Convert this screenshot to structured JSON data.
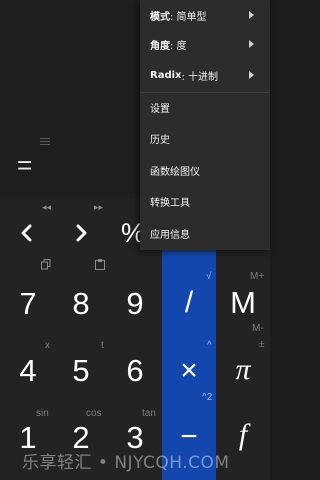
{
  "display": {
    "equals_sign": "="
  },
  "nav_row": {
    "rewind_icon": "◂◂",
    "forward_icon": "▸▸",
    "percent_label": "%"
  },
  "clipboard_row": {
    "copy_icon": "copy-icon",
    "paste_icon": "paste-icon"
  },
  "keypad": {
    "row1": {
      "d7": "7",
      "d8": "8",
      "d9": "9",
      "div": "/",
      "mem": "M"
    },
    "row2": {
      "d4": "4",
      "d5": "5",
      "d6": "6",
      "mul": "×",
      "pi": "π"
    },
    "row3": {
      "d1": "1",
      "d2": "2",
      "d3": "3",
      "sub": "−",
      "func": "f"
    },
    "secondary": {
      "sqrt": "√",
      "m_plus": "M+",
      "x": "x",
      "t": "t",
      "caret": "^",
      "m_minus": "M-",
      "pm": "±",
      "sin": "sin",
      "cos": "cos",
      "tan": "tan",
      "pow2": "^2"
    }
  },
  "menu": {
    "mode_label": "模式",
    "mode_value": ": 简单型",
    "angle_label": "角度",
    "angle_value": ": 度",
    "radix_label": "Radix",
    "radix_value": ": 十进制",
    "settings": "设置",
    "history": "历史",
    "plot": "函数绘图仪",
    "converter": "转换工具",
    "app_info": "应用信息"
  },
  "watermark": "乐享轻汇 • NJYCQH.COM",
  "colors": {
    "accent_blue": "#1347ad",
    "keypad_bg": "#232323",
    "menu_bg": "#2c2c2c"
  }
}
